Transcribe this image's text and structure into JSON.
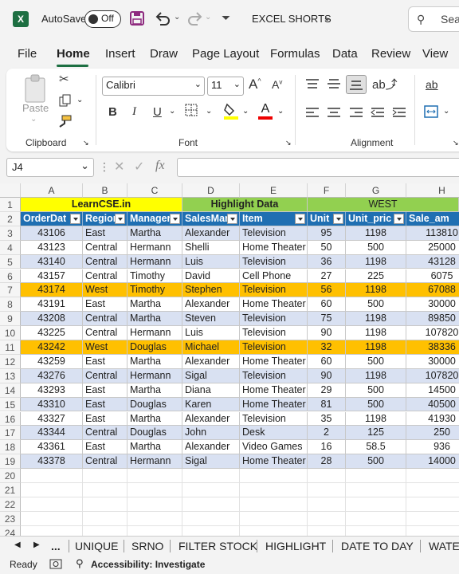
{
  "titlebar": {
    "autosave_label": "AutoSave",
    "autosave_state": "Off",
    "file_title": "EXCEL SHORTS",
    "search_text": "Sea"
  },
  "menu": [
    "File",
    "Home",
    "Insert",
    "Draw",
    "Page Layout",
    "Formulas",
    "Data",
    "Review",
    "View"
  ],
  "menu_active": "Home",
  "ribbon": {
    "paste_label": "Paste",
    "clipboard_label": "Clipboard",
    "font_name": "Calibri",
    "font_size": "11",
    "font_label": "Font",
    "alignment_label": "Alignment",
    "bold": "B",
    "italic": "I",
    "underline": "U",
    "grow_font": "A",
    "shrink_font": "A",
    "font_color_letter": "A",
    "wrap_glyph": "ab"
  },
  "formula_bar": {
    "name_box": "J4",
    "fx_label": "fx",
    "formula": ""
  },
  "sheet": {
    "columns": [
      "A",
      "B",
      "C",
      "D",
      "E",
      "F",
      "G",
      "H"
    ],
    "row1": {
      "learncse": "LearnCSE.in",
      "highlight": "Highlight Data",
      "west": "WEST"
    },
    "headers": [
      "OrderDat",
      "Region",
      "Manager",
      "SalesMan",
      "Item",
      "Unit",
      "Unit_pric",
      "Sale_am"
    ],
    "rows": [
      [
        "43106",
        "East",
        "Martha",
        "Alexander",
        "Television",
        "95",
        "1198",
        "113810"
      ],
      [
        "43123",
        "Central",
        "Hermann",
        "Shelli",
        "Home Theater",
        "50",
        "500",
        "25000"
      ],
      [
        "43140",
        "Central",
        "Hermann",
        "Luis",
        "Television",
        "36",
        "1198",
        "43128"
      ],
      [
        "43157",
        "Central",
        "Timothy",
        "David",
        "Cell Phone",
        "27",
        "225",
        "6075"
      ],
      [
        "43174",
        "West",
        "Timothy",
        "Stephen",
        "Television",
        "56",
        "1198",
        "67088"
      ],
      [
        "43191",
        "East",
        "Martha",
        "Alexander",
        "Home Theater",
        "60",
        "500",
        "30000"
      ],
      [
        "43208",
        "Central",
        "Martha",
        "Steven",
        "Television",
        "75",
        "1198",
        "89850"
      ],
      [
        "43225",
        "Central",
        "Hermann",
        "Luis",
        "Television",
        "90",
        "1198",
        "107820"
      ],
      [
        "43242",
        "West",
        "Douglas",
        "Michael",
        "Television",
        "32",
        "1198",
        "38336"
      ],
      [
        "43259",
        "East",
        "Martha",
        "Alexander",
        "Home Theater",
        "60",
        "500",
        "30000"
      ],
      [
        "43276",
        "Central",
        "Hermann",
        "Sigal",
        "Television",
        "90",
        "1198",
        "107820"
      ],
      [
        "43293",
        "East",
        "Martha",
        "Diana",
        "Home Theater",
        "29",
        "500",
        "14500"
      ],
      [
        "43310",
        "East",
        "Douglas",
        "Karen",
        "Home Theater",
        "81",
        "500",
        "40500"
      ],
      [
        "43327",
        "East",
        "Martha",
        "Alexander",
        "Television",
        "35",
        "1198",
        "41930"
      ],
      [
        "43344",
        "Central",
        "Douglas",
        "John",
        "Desk",
        "2",
        "125",
        "250"
      ],
      [
        "43361",
        "East",
        "Martha",
        "Alexander",
        "Video Games",
        "16",
        "58.5",
        "936"
      ],
      [
        "43378",
        "Central",
        "Hermann",
        "Sigal",
        "Home Theater",
        "28",
        "500",
        "14000"
      ]
    ],
    "row_numbers": [
      "1",
      "2",
      "3",
      "4",
      "5",
      "6",
      "7",
      "8",
      "9",
      "10",
      "11",
      "12",
      "13",
      "14",
      "15",
      "16",
      "17",
      "18",
      "19",
      "20",
      "21",
      "22",
      "23",
      "24"
    ],
    "highlighted_rows": [
      7,
      11
    ],
    "colors": {
      "highlight_row": "#ffc000",
      "band_row": "#d9e1f2",
      "header_blue": "#1f6fb2",
      "learncse_yellow": "#ffff00",
      "green": "#92d050"
    }
  },
  "sheet_tabs": [
    "...",
    "UNIQUE",
    "SRNO",
    "FILTER STOCK",
    "HIGHLIGHT",
    "DATE TO DAY",
    "WATE"
  ],
  "status": {
    "ready": "Ready",
    "accessibility": "Accessibility: Investigate"
  }
}
